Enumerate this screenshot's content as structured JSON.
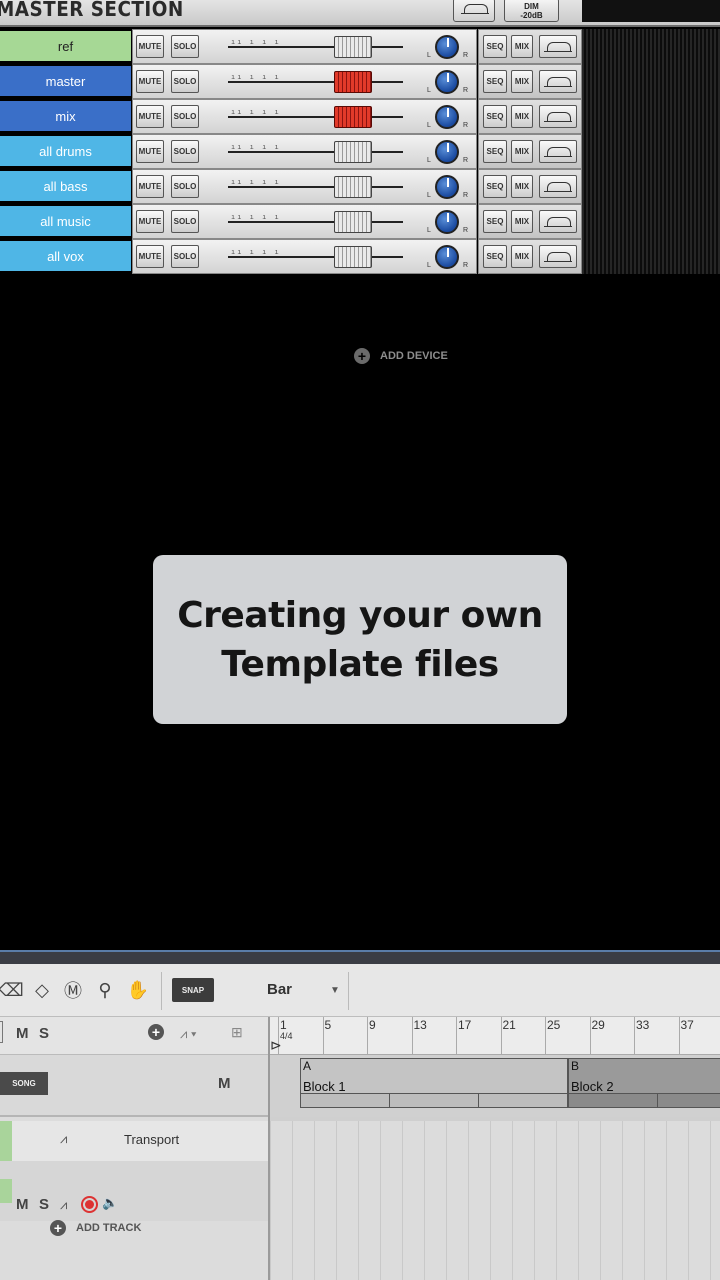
{
  "master_section": {
    "title": "MASTER SECTION",
    "dim_label": "DIM\n-20dB"
  },
  "channels": [
    {
      "name": "ref",
      "color": "#a6d895",
      "text_color": "#222222",
      "fader": "grey"
    },
    {
      "name": "master",
      "color": "#3a6fc8",
      "text_color": "#ffffff",
      "fader": "red"
    },
    {
      "name": "mix",
      "color": "#3a6fc8",
      "text_color": "#ffffff",
      "fader": "red"
    },
    {
      "name": "all drums",
      "color": "#4fb6e6",
      "text_color": "#ffffff",
      "fader": "grey"
    },
    {
      "name": "all bass",
      "color": "#4fb6e6",
      "text_color": "#ffffff",
      "fader": "grey"
    },
    {
      "name": "all music",
      "color": "#4fb6e6",
      "text_color": "#ffffff",
      "fader": "grey"
    },
    {
      "name": "all vox",
      "color": "#4fb6e6",
      "text_color": "#ffffff",
      "fader": "grey"
    }
  ],
  "channel_labels": {
    "mute": "MUTE",
    "solo": "SOLO",
    "seq": "SEQ",
    "mix": "MIX",
    "left": "L",
    "right": "R"
  },
  "rack": {
    "add_device": "ADD DEVICE"
  },
  "overlay": {
    "text": "Creating your own\nTemplate files"
  },
  "sequencer": {
    "snap_label": "SNAP",
    "snap_value": "Bar",
    "header": {
      "m": "M",
      "s": "S"
    },
    "song_label": "SONG",
    "song_m": "M",
    "transport_label": "Transport",
    "add_track": "ADD TRACK",
    "time_signature": "4/4",
    "ruler_bars": [
      "1",
      "5",
      "9",
      "13",
      "17",
      "21",
      "25",
      "29",
      "33",
      "37"
    ],
    "blocks": [
      {
        "letter": "A",
        "name": "Block 1"
      },
      {
        "letter": "B",
        "name": "Block 2"
      }
    ]
  },
  "colors": {
    "accent_blue": "#3a6fc8",
    "light_blue": "#4fb6e6",
    "green": "#a6d895"
  }
}
